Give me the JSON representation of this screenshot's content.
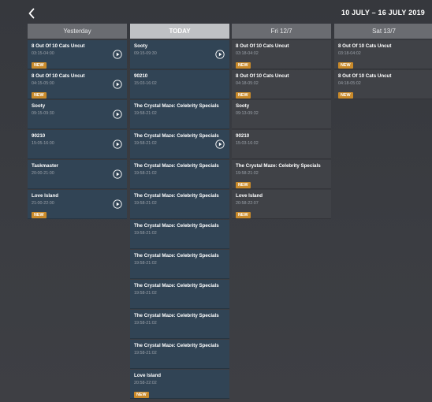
{
  "header": {
    "back_icon": "chevron-left-icon",
    "date_range": "10 JULY – 16 JULY 2019"
  },
  "days": [
    {
      "label": "Yesterday",
      "today": false
    },
    {
      "label": "TODAY",
      "today": true
    },
    {
      "label": "Fri 12/7",
      "today": false
    },
    {
      "label": "Sat 13/7",
      "today": false
    }
  ],
  "columns": [
    {
      "programmes": [
        {
          "title": "8 Out Of 10 Cats Uncut",
          "time": "03:15-04:00",
          "badge": "NEW",
          "playable": true
        },
        {
          "title": "8 Out Of 10 Cats Uncut",
          "time": "04:15-05:00",
          "badge": "NEW",
          "playable": true
        },
        {
          "title": "Sooty",
          "time": "09:15-09:30",
          "badge": "",
          "playable": true
        },
        {
          "title": "90210",
          "time": "15:05-16:00",
          "badge": "",
          "playable": true
        },
        {
          "title": "Taskmaster",
          "time": "20:00-21:00",
          "badge": "",
          "playable": true
        },
        {
          "title": "Love Island",
          "time": "21:00-22:00",
          "badge": "NEW",
          "playable": true
        }
      ]
    },
    {
      "programmes": [
        {
          "title": "Sooty",
          "time": "09:15-09:30",
          "badge": "",
          "playable": true
        },
        {
          "title": "90210",
          "time": "15:03-16:02",
          "badge": "",
          "playable": false
        },
        {
          "title": "The Crystal Maze: Celebrity Specials",
          "time": "19:58-21:02",
          "badge": "",
          "playable": false
        },
        {
          "title": "The Crystal Maze: Celebrity Specials",
          "time": "19:58-21:02",
          "badge": "",
          "playable": true
        },
        {
          "title": "The Crystal Maze: Celebrity Specials",
          "time": "19:58-21:02",
          "badge": "",
          "playable": false
        },
        {
          "title": "The Crystal Maze: Celebrity Specials",
          "time": "19:58-21:02",
          "badge": "",
          "playable": false
        },
        {
          "title": "The Crystal Maze: Celebrity Specials",
          "time": "19:58-21:02",
          "badge": "",
          "playable": false
        },
        {
          "title": "The Crystal Maze: Celebrity Specials",
          "time": "19:58-21:02",
          "badge": "",
          "playable": false
        },
        {
          "title": "The Crystal Maze: Celebrity Specials",
          "time": "19:58-21:02",
          "badge": "",
          "playable": false
        },
        {
          "title": "The Crystal Maze: Celebrity Specials",
          "time": "19:58-21:02",
          "badge": "",
          "playable": false
        },
        {
          "title": "The Crystal Maze: Celebrity Specials",
          "time": "19:58-21:02",
          "badge": "",
          "playable": false
        },
        {
          "title": "Love Island",
          "time": "20:58-22:02",
          "badge": "NEW",
          "playable": false
        }
      ]
    },
    {
      "programmes": [
        {
          "title": "8 Out Of 10 Cats Uncut",
          "time": "03:18-04:02",
          "badge": "NEW",
          "playable": false
        },
        {
          "title": "8 Out Of 10 Cats Uncut",
          "time": "04:18-05:02",
          "badge": "NEW",
          "playable": false
        },
        {
          "title": "Sooty",
          "time": "09:13-09:32",
          "badge": "",
          "playable": false
        },
        {
          "title": "90210",
          "time": "15:03-16:02",
          "badge": "",
          "playable": false
        },
        {
          "title": "The Crystal Maze: Celebrity Specials",
          "time": "19:58-21:02",
          "badge": "NEW",
          "playable": false
        },
        {
          "title": "Love Island",
          "time": "20:58-22:07",
          "badge": "NEW",
          "playable": false
        }
      ]
    },
    {
      "programmes": [
        {
          "title": "8 Out Of 10 Cats Uncut",
          "time": "03:18-04:02",
          "badge": "NEW",
          "playable": false
        },
        {
          "title": "8 Out Of 10 Cats Uncut",
          "time": "04:18-05:02",
          "badge": "NEW",
          "playable": false
        }
      ]
    }
  ],
  "colors": {
    "past_card": "#314455",
    "today_card": "#314455",
    "future_card": "#404247",
    "new_badge": "#c98a2a"
  }
}
